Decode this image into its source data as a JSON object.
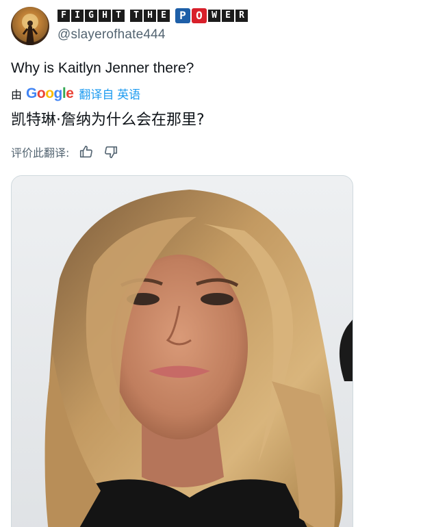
{
  "author": {
    "display_name_tiles": [
      "F",
      "I",
      "G",
      "H",
      "T",
      "",
      "T",
      "H",
      "E",
      "",
      "P",
      "O",
      "W",
      "E",
      "R"
    ],
    "display_name": "FIGHT THE POWER",
    "handle": "@slayerofhate444"
  },
  "tweet": {
    "text": "Why is Kaitlyn Jenner there?"
  },
  "translation": {
    "by_label": "由",
    "provider_letters": [
      "G",
      "o",
      "o",
      "g",
      "l",
      "e"
    ],
    "translated_from": "翻译自 英语",
    "text": "凯特琳·詹纳为什么会在那里?",
    "rate_label": "评价此翻译:",
    "thumbs_up_icon": "thumbs-up-icon",
    "thumbs_down_icon": "thumbs-down-icon"
  },
  "media": {
    "kind": "photo",
    "subject": "portrait of a woman with long blonde hair"
  },
  "colors": {
    "text_primary": "#0f1419",
    "text_secondary": "#536471",
    "link": "#1d9bf0",
    "border": "#cfd9de",
    "google_blue": "#4285F4",
    "google_red": "#EA4335",
    "google_yellow": "#FBBC05",
    "google_green": "#34A853",
    "name_tile_dark": "#1c1c1c",
    "name_tile_blue": "#1e5fa8",
    "name_tile_red": "#d8202b"
  }
}
